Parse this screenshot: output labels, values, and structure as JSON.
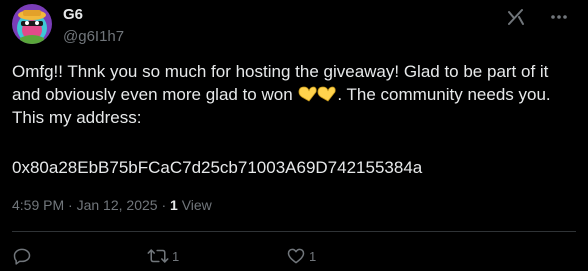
{
  "user": {
    "display_name": "G6",
    "handle": "@g6I1h7"
  },
  "tweet": {
    "text_line1": "Omfg!! Thnk you so much for hosting the giveaway! Glad to be part of it",
    "text_line2_before": "and obviously even more glad to won ",
    "text_line2_after": ". The community needs you.",
    "text_line3": "This my address:",
    "address": "0x80a28EbB75bFCaC7d25cb71003A69D742155384a"
  },
  "meta": {
    "time": "4:59 PM",
    "separator": "·",
    "date": "Jan 12, 2025",
    "views_count": "1",
    "views_label": "View"
  },
  "actions": {
    "reply_count": "",
    "retweet_count": "1",
    "like_count": "1"
  },
  "colors": {
    "background": "#000000",
    "text": "#e7e9ea",
    "secondary": "#71767b",
    "divider": "#2f3336",
    "heart_emoji": "#ffd34d"
  },
  "icons": [
    "grok-icon",
    "more-icon",
    "heart-hands-emoji",
    "reply-icon",
    "retweet-icon",
    "like-icon"
  ]
}
